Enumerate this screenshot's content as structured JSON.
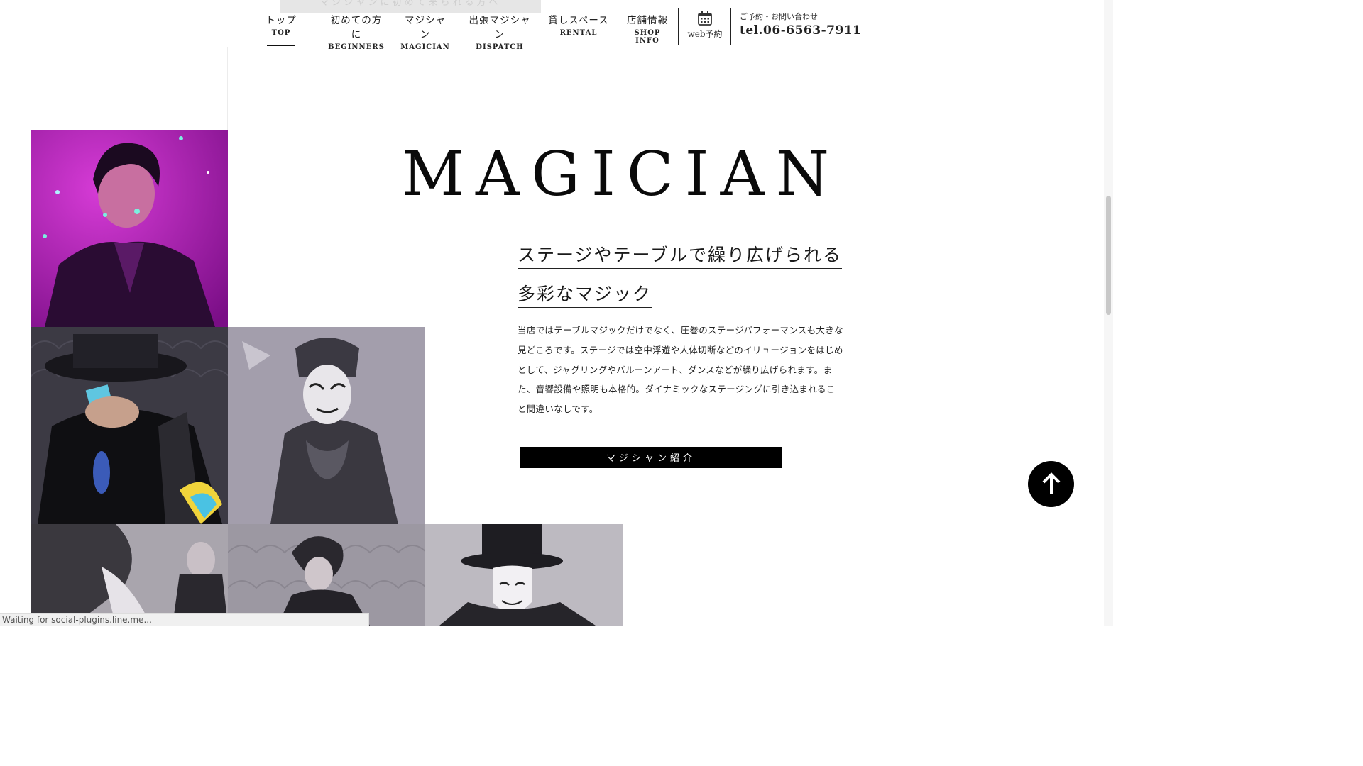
{
  "peek_banner": "マジシャンに初めて来られる方へ",
  "nav": {
    "items": [
      {
        "jp": "トップ",
        "en": "TOP"
      },
      {
        "jp": "初めての方に",
        "en": "BEGINNERS"
      },
      {
        "jp": "マジシャン",
        "en": "MAGICIAN"
      },
      {
        "jp": "出張マジシャン",
        "en": "DISPATCH"
      },
      {
        "jp": "貸しスペース",
        "en": "RENTAL"
      },
      {
        "jp": "店舗情報",
        "en": "SHOP INFO"
      }
    ],
    "active": "TOP",
    "web_reserve": "web予約",
    "contact_label": "ご予約・お問い合わせ",
    "tel": "tel.06-6563-7911"
  },
  "section": {
    "title": "MAGICIAN",
    "headline_line1": "ステージやテーブルで繰り広げられる",
    "headline_line2": "多彩なマジック",
    "description": "当店ではテーブルマジックだけでなく、圧巻のステージパフォーマンスも大きな見どころです。ステージでは空中浮遊や人体切断などのイリュージョンをはじめとして、ジャグリングやバルーンアート、ダンスなどが繰り広げられます。また、音響設備や照明も本格的。ダイナミックなステージングに引き込まれること間違いなしです。",
    "cta": "マジシャン紹介"
  },
  "status_bar": "Waiting for social-plugins.line.me...",
  "colors": {
    "accent": "#000000",
    "photo_magenta": "#b21bb2"
  }
}
